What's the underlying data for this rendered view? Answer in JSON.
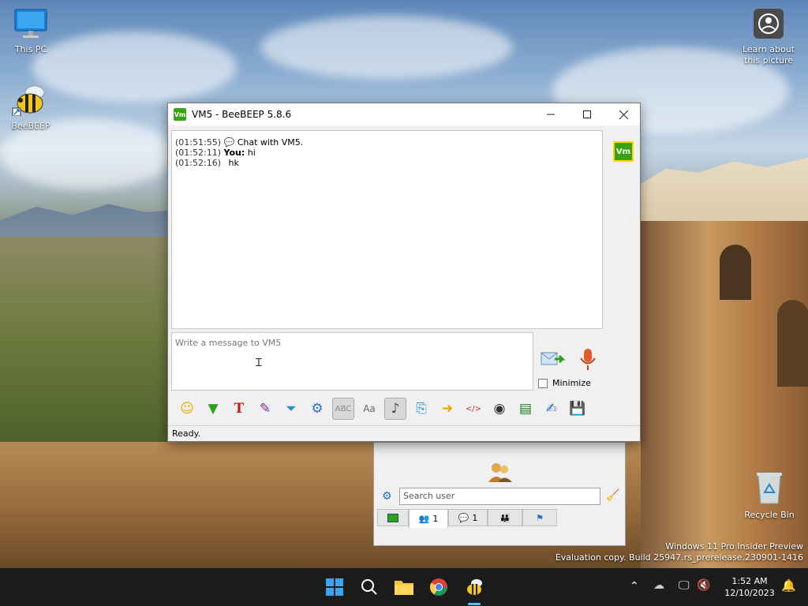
{
  "desktop": {
    "icons": [
      {
        "label": "This PC"
      },
      {
        "label": "BeeBEEP"
      },
      {
        "label": "Learn about this picture"
      },
      {
        "label": "Recycle Bin"
      }
    ],
    "watermark_line1": "Windows 11 Pro Insider Preview",
    "watermark_line2": "Evaluation copy. Build 25947.rs_prerelease.230901-1416"
  },
  "window": {
    "title": "VM5 - BeeBEEP 5.8.6",
    "app_icon_text": "Vm",
    "avatar_text": "Vm",
    "messages": [
      {
        "time": "(01:51:55)",
        "sender": "",
        "text": "Chat with VM5."
      },
      {
        "time": "(01:52:11)",
        "sender": "You:",
        "text": "hi"
      },
      {
        "time": "(01:52:16)",
        "sender": "",
        "text": "hk"
      }
    ],
    "input_placeholder": "Write a message to VM5",
    "minimize_label": "Minimize",
    "status": "Ready.",
    "toolbar": [
      "smiley-icon",
      "green-arrow-icon",
      "text-format-icon",
      "color-picker-icon",
      "filter-icon",
      "settings-icon",
      "spellcheck-icon",
      "font-icon",
      "music-note-icon",
      "save-chat-icon",
      "send-file-icon",
      "html-icon",
      "screenshot-icon",
      "terminal-icon",
      "notes-icon",
      "save-icon"
    ]
  },
  "panel": {
    "search_placeholder": "Search user",
    "tabs": [
      {
        "icon": "chat-green-icon",
        "count": ""
      },
      {
        "icon": "users-icon",
        "count": "1"
      },
      {
        "icon": "chats-icon",
        "count": "1"
      },
      {
        "icon": "groups-icon",
        "count": ""
      },
      {
        "icon": "flag-icon",
        "count": ""
      }
    ]
  },
  "taskbar": {
    "time": "1:52 AM",
    "date": "12/10/2023"
  }
}
